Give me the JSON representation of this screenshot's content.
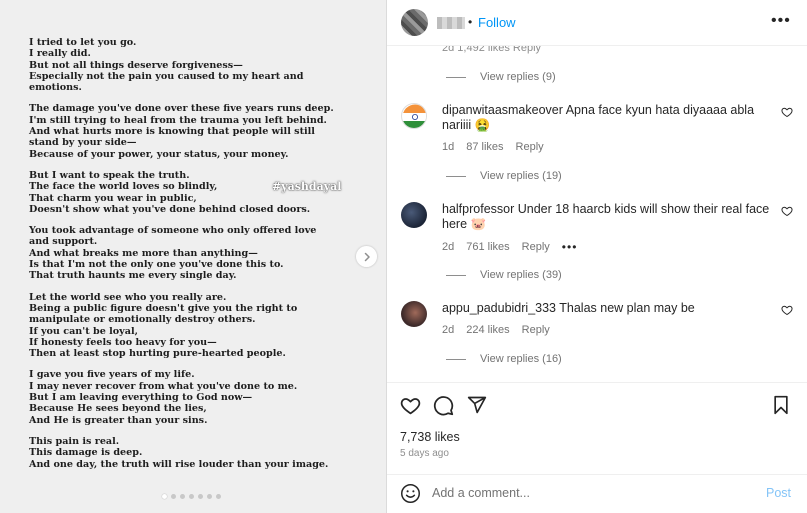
{
  "post": {
    "poem_stanzas": [
      [
        "I tried to let you go.",
        "I really did.",
        "But not all things deserve forgiveness—",
        "Especially not the pain you caused to my heart and",
        "emotions."
      ],
      [
        "The damage you've done over these five years runs deep.",
        "I'm still trying to heal from the trauma you left behind.",
        "And what hurts more is knowing that people will still",
        "stand by your side—",
        "Because of your power, your status, your money."
      ],
      [
        "But I want to speak the truth.",
        "The face the world loves so blindly,",
        "That charm you wear in public,",
        "Doesn't show what you've done behind closed doors."
      ],
      [
        "You took advantage of someone who only offered love",
        "and support.",
        "And what breaks me more than anything—",
        "Is that I'm not the only one you've done this to.",
        "That truth haunts me every single day."
      ],
      [
        "Let the world see who you really are.",
        "Being a public figure doesn't give you the right to",
        "manipulate or emotionally destroy others.",
        "If you can't be loyal,",
        "If honesty feels too heavy for you—",
        "Then at least stop hurting pure-hearted people."
      ],
      [
        "I gave you five years of my life.",
        "I may never recover from what you've done to me.",
        "But I am leaving everything to God now—",
        "Because He sees beyond the lies,",
        "And He is greater than your sins."
      ],
      [
        "This pain is real.",
        "This damage is deep.",
        "And one day, the truth will rise louder than your image."
      ]
    ],
    "hashtag": "#yashdayal",
    "carousel": {
      "count": 7,
      "active_index": 0
    }
  },
  "header": {
    "follow_label": "Follow",
    "separator": "•",
    "more_icon": "more-horizontal-icon"
  },
  "comments": {
    "partial_meta": "2d   1,492 likes   Reply",
    "thread0_replies": "View replies (9)",
    "items": [
      {
        "username": "dipanwitaasmakeover",
        "text": "Apna face kyun hata diyaaaa abla nariiii 🤮",
        "time": "1d",
        "likes": "87 likes",
        "reply": "Reply",
        "view_replies": "View replies (19)",
        "avatar_icon": "india-flag-icon"
      },
      {
        "username": "halfprofessor",
        "text": "Under 18 haarcb kids will show their real face here 🐷",
        "time": "2d",
        "likes": "761 likes",
        "reply": "Reply",
        "more": "•••",
        "view_replies": "View replies (39)",
        "avatar_icon": "profile-photo-icon"
      },
      {
        "username": "appu_padubidri_333",
        "text": "Thalas new plan may be",
        "time": "2d",
        "likes": "224 likes",
        "reply": "Reply",
        "view_replies": "View replies (16)",
        "avatar_icon": "profile-photo-icon"
      }
    ]
  },
  "actions": {
    "likes": "7,738 likes",
    "ago": "5 days ago"
  },
  "composer": {
    "placeholder": "Add a comment...",
    "post_label": "Post"
  },
  "colors": {
    "accent": "#0095f6",
    "post_disabled": "#84c4f7",
    "muted": "#737373",
    "text": "#262626"
  }
}
